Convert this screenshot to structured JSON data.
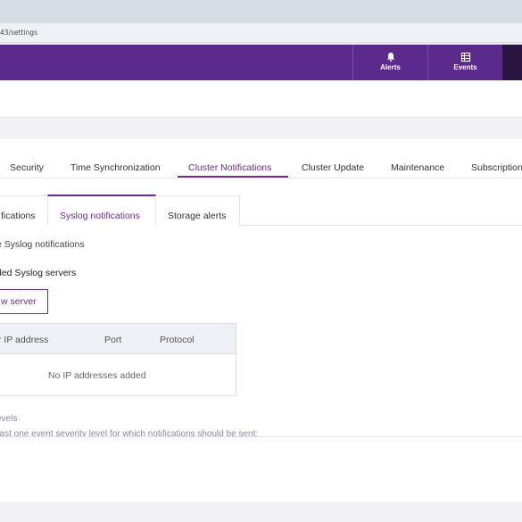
{
  "browser": {
    "url": "43/settings"
  },
  "top_nav": {
    "alerts_label": "Alerts",
    "alerts_icon": "bell-icon",
    "events_label": "Events",
    "events_icon": "list-icon"
  },
  "main_tabs": [
    {
      "label": "Security",
      "active": false
    },
    {
      "label": "Time Synchronization",
      "active": false
    },
    {
      "label": "Cluster Notifications",
      "active": true
    },
    {
      "label": "Cluster Update",
      "active": false
    },
    {
      "label": "Maintenance",
      "active": false
    },
    {
      "label": "Subscription",
      "active": false
    }
  ],
  "sub_tabs": [
    {
      "label": "fications",
      "active": false
    },
    {
      "label": "Syslog notifications",
      "active": true
    },
    {
      "label": "Storage alerts",
      "active": false
    }
  ],
  "syslog": {
    "enable_text": "e Syslog notifications",
    "servers_heading": "ded Syslog servers",
    "add_button": "w server",
    "table": {
      "columns": [
        "r IP address",
        "Port",
        "Protocol"
      ],
      "empty_text": "No IP addresses added"
    },
    "levels_title": "evels",
    "levels_desc": "east one event severity level for which notifications should be sent:"
  },
  "colors": {
    "accent": "#6a2c91",
    "nav_bg": "#5a2a8c"
  }
}
